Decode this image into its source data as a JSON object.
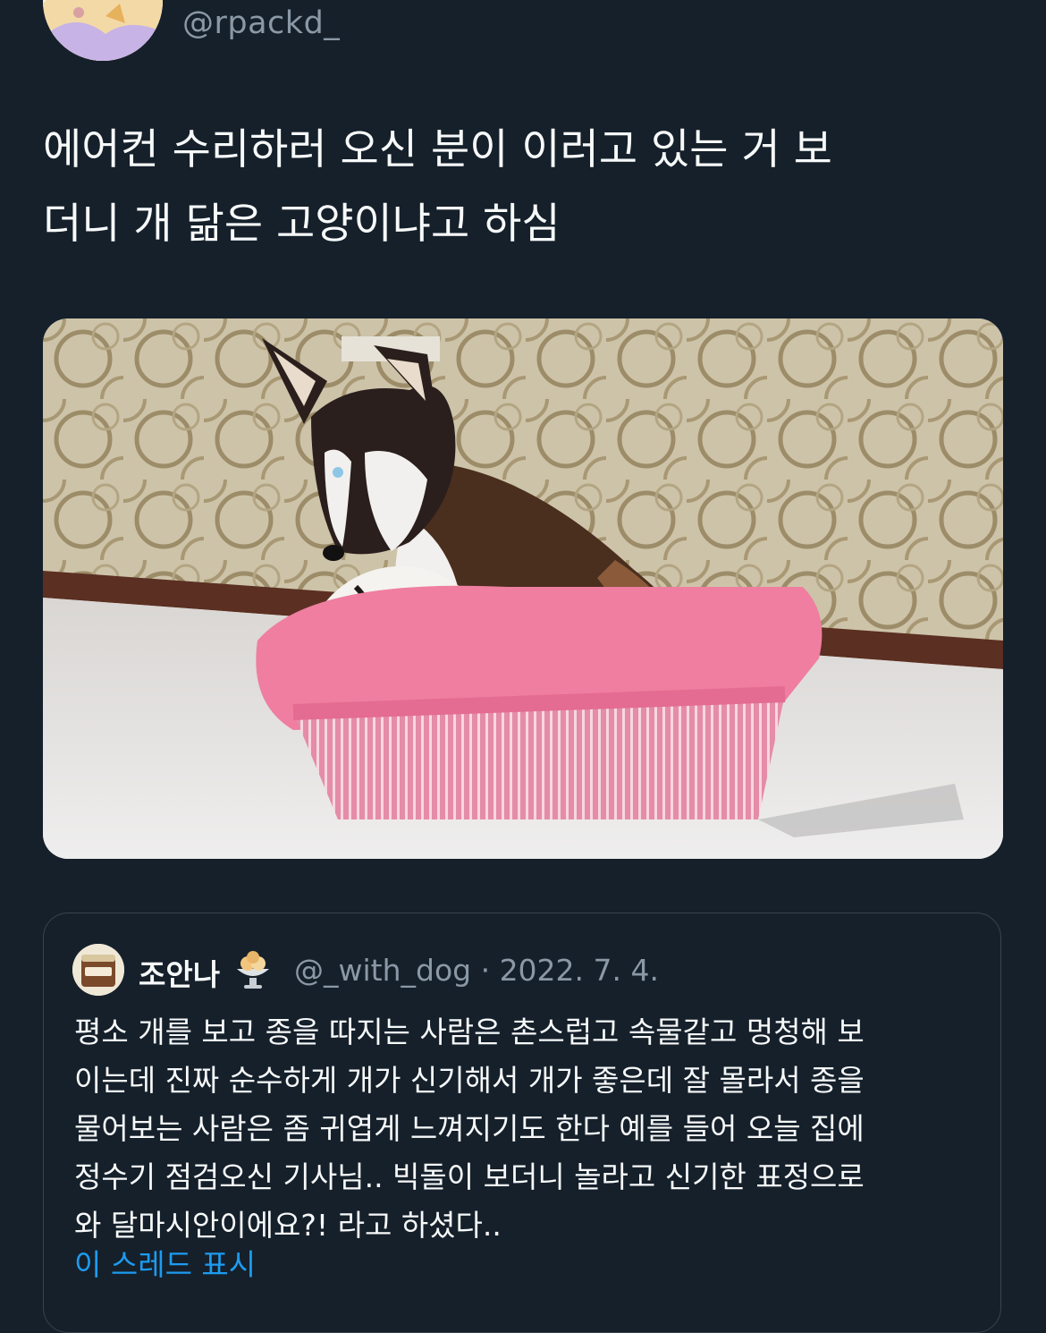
{
  "author": {
    "handle": "@rpackd_",
    "avatar_icon": "anime-character-avatar"
  },
  "tweet": {
    "text": "에어컨 수리하러 오신 분이 이러고 있는 거 보\n더니 개 닮은 고양이냐고 하심",
    "media_description_icon": "husky-in-pink-basket-photo"
  },
  "quote": {
    "display_name": "조안나",
    "name_emoji_icon": "ice-cream-sundae-icon",
    "handle_date": "@_with_dog · 2022. 7. 4.",
    "avatar_label": "조안나",
    "text": "평소 개를 보고 종을 따지는 사람은 촌스럽고 속물같고 멍청해 보\n이는데 진짜 순수하게 개가 신기해서 개가 좋은데 잘 몰라서 종을\n물어보는 사람은 좀 귀엽게 느껴지기도 한다 예를 들어 오늘 집에\n정수기 점검오신 기사님.. 빅돌이 보더니 놀라고 신기한 표정으로\n와 달마시안이에요?! 라고 하셨다..",
    "show_thread": "이 스레드 표시"
  },
  "colors": {
    "background": "#15202b",
    "text": "#f7f9f9",
    "secondary": "#8b98a5",
    "link": "#1d9bf0",
    "border": "#38444d"
  }
}
